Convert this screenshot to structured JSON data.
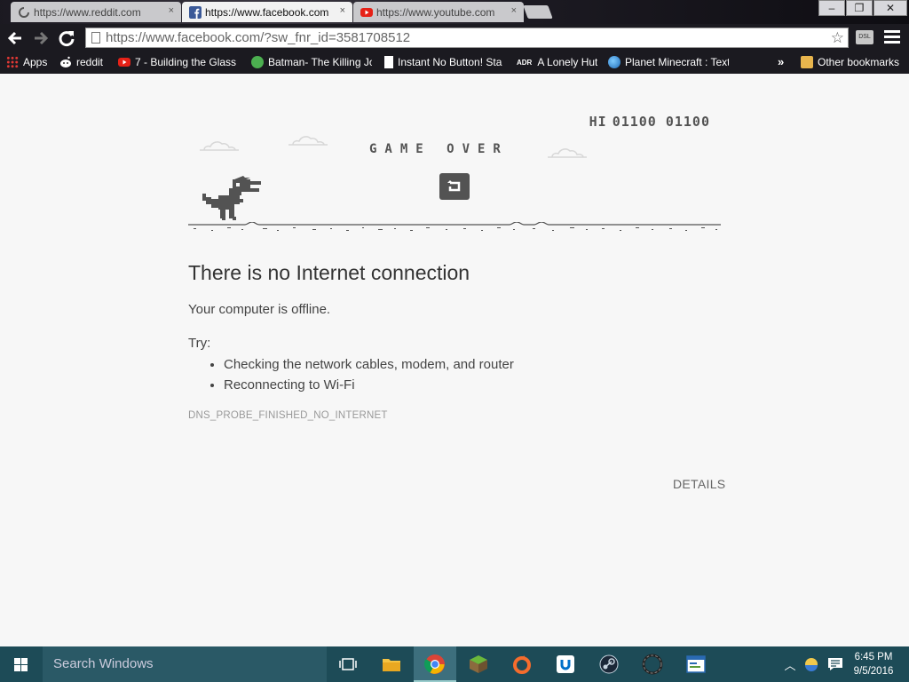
{
  "browser": {
    "tabs": [
      {
        "title": "https://www.reddit.com",
        "icon": "loading-spinner-icon",
        "state": "inactive"
      },
      {
        "title": "https://www.facebook.com",
        "icon": "facebook-icon",
        "state": "active"
      },
      {
        "title": "https://www.youtube.com",
        "icon": "youtube-icon",
        "state": "inactive"
      }
    ],
    "close_glyph": "×",
    "url": "https://www.facebook.com/?sw_fnr_id=3581708512",
    "extension_label": "DSL",
    "bookmarks": [
      {
        "label": "Apps",
        "icon": "apps-grid-icon"
      },
      {
        "label": "reddit",
        "icon": "reddit-icon"
      },
      {
        "label": "7 - Building the Glass",
        "icon": "youtube-icon"
      },
      {
        "label": "Batman- The Killing Jo",
        "icon": "green-circle-icon"
      },
      {
        "label": "Instant No Button! Sta",
        "icon": "page-icon"
      },
      {
        "label": "A Lonely Hut",
        "icon": "adr-icon",
        "icon_text": "ADR"
      },
      {
        "label": "Planet Minecraft : Text",
        "icon": "globe-icon"
      }
    ],
    "overflow_glyph": "»",
    "other_bookmarks": "Other bookmarks"
  },
  "game": {
    "hi_label": "HI",
    "hi_score": "01100",
    "current_score": "01100",
    "game_over_text": "GAME OVER"
  },
  "error": {
    "title": "There is no Internet connection",
    "subtitle": "Your computer is offline.",
    "try_label": "Try:",
    "suggestions": [
      "Checking the network cables, modem, and router",
      "Reconnecting to Wi-Fi"
    ],
    "code": "DNS_PROBE_FINISHED_NO_INTERNET",
    "details_button": "DETAILS"
  },
  "taskbar": {
    "search_placeholder": "Search Windows",
    "apps": [
      "task-view-icon",
      "file-explorer-icon",
      "chrome-icon",
      "minecraft-icon",
      "origin-icon",
      "uplay-icon",
      "steam-icon",
      "circle-app-icon",
      "app-window-icon"
    ],
    "time": "6:45 PM",
    "date": "9/5/2016"
  },
  "colors": {
    "page_bg": "#f7f7f7",
    "game_gray": "#535353",
    "taskbar_bg": "#1d4b57",
    "browser_dark": "#1b1a20"
  }
}
